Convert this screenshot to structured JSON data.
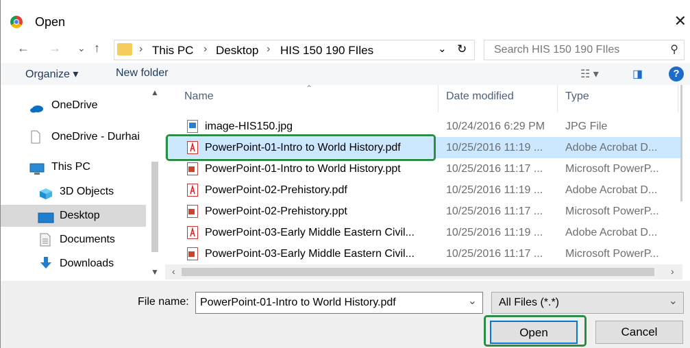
{
  "window": {
    "title": "Open",
    "close_glyph": "✕"
  },
  "address_bar": {
    "back_glyph": "←",
    "forward_glyph": "→",
    "recent_glyph": "⌄",
    "up_glyph": "↑",
    "crumbs": [
      "This PC",
      "Desktop",
      "HIS 150 190 FIles"
    ],
    "sep_glyph": "›",
    "dropdown_glyph": "⌄",
    "refresh_glyph": "↻",
    "search_placeholder": "Search HIS 150 190 FIles",
    "search_glyph": "⚲"
  },
  "toolbar": {
    "organize": "Organize ▾",
    "new_folder": "New folder",
    "view_glyph": "☷ ▾",
    "pane_glyph": "◨",
    "help": "?"
  },
  "nav": [
    {
      "label": "OneDrive",
      "icon": "cloud-icon",
      "selected": false
    },
    {
      "label": "OneDrive - Durhai",
      "icon": "document-icon",
      "selected": false
    },
    {
      "label": "This PC",
      "icon": "computer-icon",
      "selected": false
    },
    {
      "label": "3D Objects",
      "icon": "cube-icon",
      "selected": false
    },
    {
      "label": "Desktop",
      "icon": "desktop-icon",
      "selected": true
    },
    {
      "label": "Documents",
      "icon": "documents-icon",
      "selected": false
    },
    {
      "label": "Downloads",
      "icon": "download-icon",
      "selected": false
    }
  ],
  "columns": {
    "name": "Name",
    "date": "Date modified",
    "type": "Type"
  },
  "files": [
    {
      "name": "image-HIS150.jpg",
      "date": "10/24/2016 6:29 PM",
      "type": "JPG File",
      "icon": "image-file-icon",
      "selected": false
    },
    {
      "name": "PowerPoint-01-Intro to World History.pdf",
      "date": "10/25/2016 11:19 ...",
      "type": "Adobe Acrobat D...",
      "icon": "pdf-file-icon",
      "selected": true
    },
    {
      "name": "PowerPoint-01-Intro to World History.ppt",
      "date": "10/25/2016 11:17 ...",
      "type": "Microsoft PowerP...",
      "icon": "ppt-file-icon",
      "selected": false
    },
    {
      "name": "PowerPoint-02-Prehistory.pdf",
      "date": "10/25/2016 11:19 ...",
      "type": "Adobe Acrobat D...",
      "icon": "pdf-file-icon",
      "selected": false
    },
    {
      "name": "PowerPoint-02-Prehistory.ppt",
      "date": "10/25/2016 11:17 ...",
      "type": "Microsoft PowerP...",
      "icon": "ppt-file-icon",
      "selected": false
    },
    {
      "name": "PowerPoint-03-Early Middle Eastern Civil...",
      "date": "10/25/2016 11:19 ...",
      "type": "Adobe Acrobat D...",
      "icon": "pdf-file-icon",
      "selected": false
    },
    {
      "name": "PowerPoint-03-Early Middle Eastern Civil...",
      "date": "10/25/2016 11:17 ...",
      "type": "Microsoft PowerP...",
      "icon": "ppt-file-icon",
      "selected": false
    }
  ],
  "footer": {
    "file_name_label": "File name:",
    "file_name_value": "PowerPoint-01-Intro to World History.pdf",
    "file_type_value": "All Files (*.*)",
    "open_label": "Open",
    "cancel_label": "Cancel",
    "dropdown_glyph": "⌄"
  },
  "colors": {
    "highlight": "#2b8e46",
    "selection": "#cce8ff",
    "accent": "#0078d7"
  }
}
